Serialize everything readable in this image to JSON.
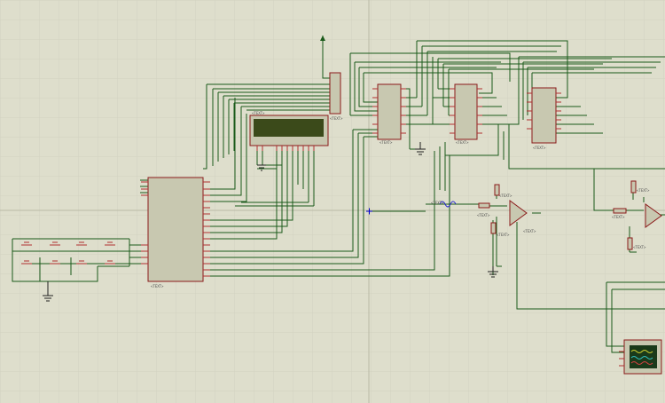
{
  "app": "Schematic capture canvas",
  "colors": {
    "background": "#dedecc",
    "grid_minor": "#cfcfbd",
    "grid_major": "#b9b9a6",
    "wire": "#1a5a1a",
    "component_border": "#8b1a1a",
    "component_fill": "#c8c8b0",
    "pin": "#b03030",
    "lcd_screen": "#3b4a1a",
    "scope_screen": "#1a3a1a",
    "origin_marker": "#0000cc",
    "ground": "#202020"
  },
  "component_label": "<TEXT>",
  "components": [
    {
      "id": "keypad-switch-array",
      "kind": "push buttons"
    },
    {
      "id": "microcontroller",
      "kind": "IC"
    },
    {
      "id": "lcd-display",
      "kind": "LCD module"
    },
    {
      "id": "connector-header",
      "kind": "SIL header"
    },
    {
      "id": "ic-1",
      "kind": "IC"
    },
    {
      "id": "ic-2",
      "kind": "IC"
    },
    {
      "id": "ic-3",
      "kind": "IC"
    },
    {
      "id": "opamp-1",
      "kind": "operational amplifier"
    },
    {
      "id": "opamp-2",
      "kind": "operational amplifier"
    },
    {
      "id": "oscilloscope",
      "kind": "virtual instrument"
    },
    {
      "id": "signal-source",
      "kind": "sine generator"
    }
  ]
}
